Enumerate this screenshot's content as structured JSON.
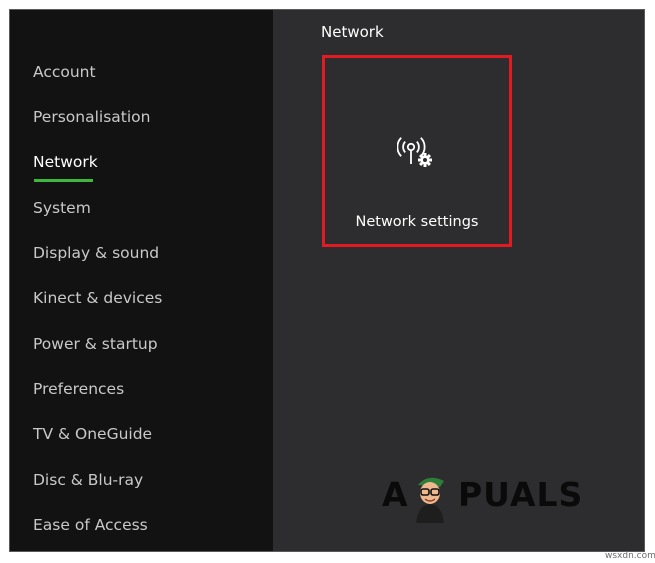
{
  "header": {
    "title": "Network"
  },
  "sidebar": {
    "items": [
      {
        "label": "Account"
      },
      {
        "label": "Personalisation"
      },
      {
        "label": "Network"
      },
      {
        "label": "System"
      },
      {
        "label": "Display & sound"
      },
      {
        "label": "Kinect & devices"
      },
      {
        "label": "Power & startup"
      },
      {
        "label": "Preferences"
      },
      {
        "label": "TV & OneGuide"
      },
      {
        "label": "Disc & Blu-ray"
      },
      {
        "label": "Ease of Access"
      }
    ],
    "active_index": 2,
    "active_color": "#3db83d"
  },
  "main": {
    "tile": {
      "label": "Network settings",
      "icon": "network-antenna-gear-icon",
      "highlight_color": "#e01b22"
    }
  },
  "watermark": {
    "left": "A",
    "right": "PUALS"
  },
  "source_label": "wsxdn.com",
  "colors": {
    "sidebar_bg": "#121212",
    "content_bg": "#2d2c2e",
    "text": "#ffffff",
    "muted_text": "#c9c9c9"
  }
}
